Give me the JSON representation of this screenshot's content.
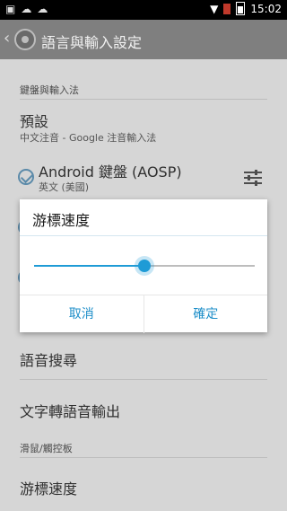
{
  "status_bar": {
    "time": "15:02",
    "left_icons": [
      "image-icon",
      "cloud-icon",
      "cloud-icon"
    ]
  },
  "app_bar": {
    "title": "語言與輸入設定"
  },
  "settings": {
    "section_keyboard": "鍵盤與輸入法",
    "default_title": "預設",
    "default_sub": "中文注音 - Google 注音輸入法",
    "aosp_title": "Android 鍵盤 (AOSP)",
    "aosp_sub": "英文 (美國)",
    "voice_search": "語音搜尋",
    "tts": "文字轉語音輸出",
    "section_mouse": "滑鼠/觸控板",
    "pointer_speed": "游標速度"
  },
  "dialog": {
    "title": "游標速度",
    "slider_fraction": 0.5,
    "cancel": "取消",
    "ok": "確定"
  },
  "colors": {
    "accent": "#1f9bd6",
    "app_bar": "#7f7f7f",
    "background_dim": "#d6d6d6"
  }
}
